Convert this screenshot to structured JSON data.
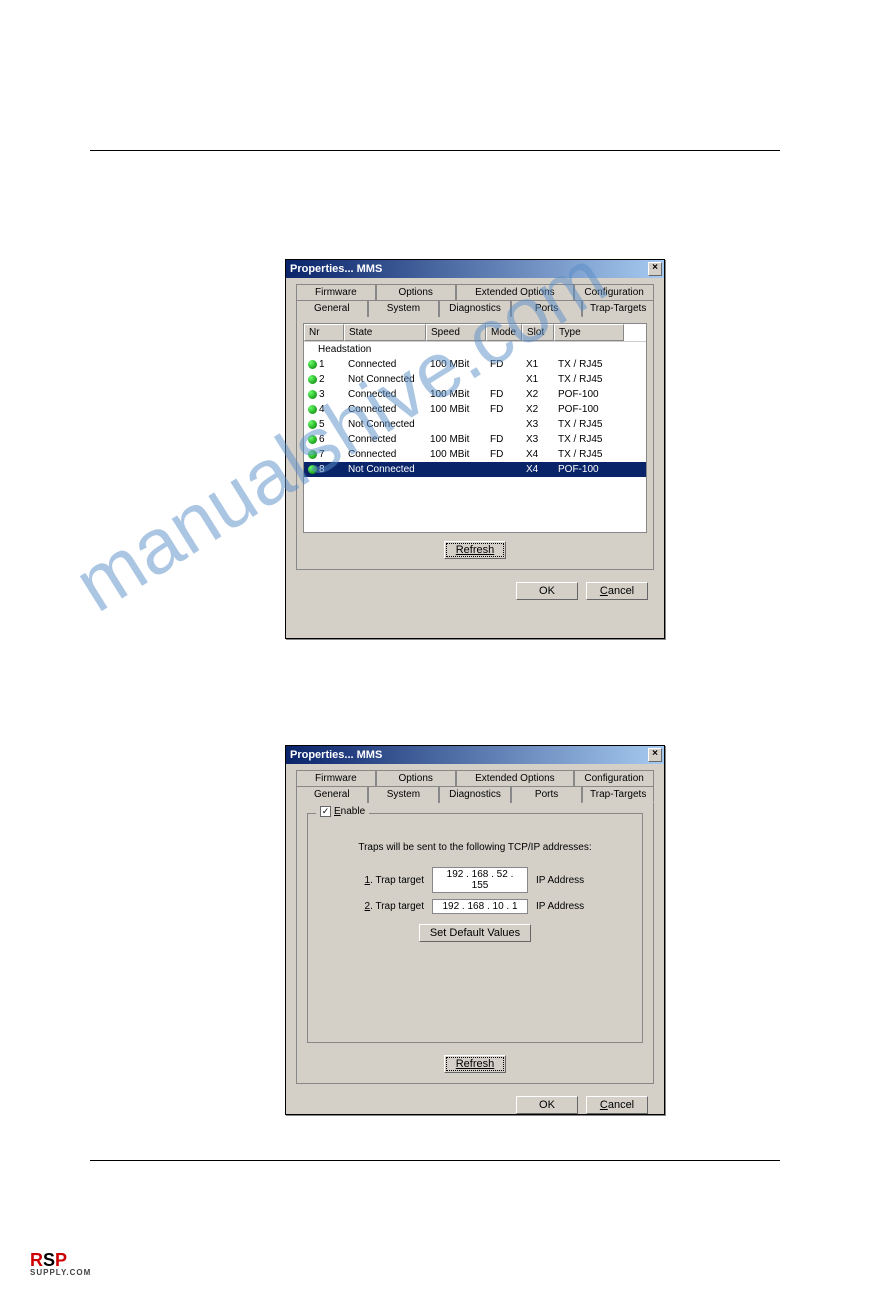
{
  "watermark": "manualshive.com",
  "logo": {
    "r": "R",
    "s": "S",
    "p": "P",
    "sub": "SUPPLY.COM"
  },
  "dlg1": {
    "title": "Properties... MMS",
    "tabs_row1": [
      "Firmware",
      "Options",
      "Extended Options",
      "Configuration"
    ],
    "tabs_row2": [
      "General",
      "System",
      "Diagnostics",
      "Ports",
      "Trap-Targets"
    ],
    "active_tab": "Ports",
    "headers": {
      "nr": "Nr",
      "state": "State",
      "speed": "Speed",
      "mode": "Mode",
      "slot": "Slot",
      "type": "Type"
    },
    "group_header": "Headstation",
    "rows": [
      {
        "nr": "1",
        "state": "Connected",
        "speed": "100 MBit",
        "mode": "FD",
        "slot": "X1",
        "type": "TX / RJ45"
      },
      {
        "nr": "2",
        "state": "Not Connected",
        "speed": "",
        "mode": "",
        "slot": "X1",
        "type": "TX / RJ45"
      },
      {
        "nr": "3",
        "state": "Connected",
        "speed": "100 MBit",
        "mode": "FD",
        "slot": "X2",
        "type": "POF-100"
      },
      {
        "nr": "4",
        "state": "Connected",
        "speed": "100 MBit",
        "mode": "FD",
        "slot": "X2",
        "type": "POF-100"
      },
      {
        "nr": "5",
        "state": "Not Connected",
        "speed": "",
        "mode": "",
        "slot": "X3",
        "type": "TX / RJ45"
      },
      {
        "nr": "6",
        "state": "Connected",
        "speed": "100 MBit",
        "mode": "FD",
        "slot": "X3",
        "type": "TX / RJ45"
      },
      {
        "nr": "7",
        "state": "Connected",
        "speed": "100 MBit",
        "mode": "FD",
        "slot": "X4",
        "type": "TX / RJ45"
      },
      {
        "nr": "8",
        "state": "Not Connected",
        "speed": "",
        "mode": "",
        "slot": "X4",
        "type": "POF-100"
      }
    ],
    "selected_row": 7,
    "refresh": "Refresh",
    "ok": "OK",
    "cancel": "Cancel"
  },
  "dlg2": {
    "title": "Properties... MMS",
    "tabs_row1": [
      "Firmware",
      "Options",
      "Extended Options",
      "Configuration"
    ],
    "tabs_row2": [
      "General",
      "System",
      "Diagnostics",
      "Ports",
      "Trap-Targets"
    ],
    "active_tab": "Trap-Targets",
    "enable": "Enable",
    "enable_checked": true,
    "intro": "Traps will be sent to the following TCP/IP addresses:",
    "t1_label": "1. Trap target",
    "t1_val": "192 . 168 . 52 . 155",
    "ip": "IP Address",
    "t2_label": "2. Trap target",
    "t2_val": "192 . 168 . 10 .  1",
    "setdef": "Set Default Values",
    "refresh": "Refresh",
    "ok": "OK",
    "cancel": "Cancel"
  }
}
